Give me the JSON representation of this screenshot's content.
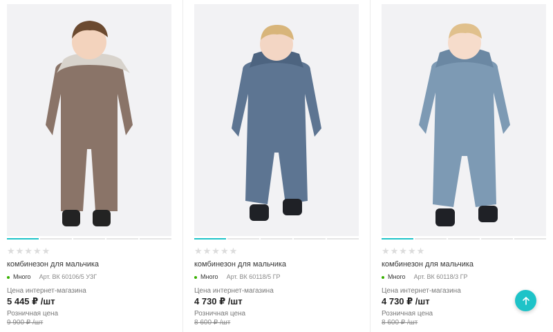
{
  "products": [
    {
      "rating_stars": "★★★★★",
      "title": "комбинезон для мальчика",
      "stock": "Много",
      "article": "Арт. ВК 60106/5 УЗГ",
      "price_label": "Цена интернет-магазина",
      "price": "5 445 ₽ /шт",
      "retail_label": "Розничная цена",
      "retail_price": "9 900 ₽ /шт",
      "suit_color": "#8a7468",
      "image_slide_active": 1,
      "image_slide_count": 5
    },
    {
      "rating_stars": "★★★★★",
      "title": "комбинезон для мальчика",
      "stock": "Много",
      "article": "Арт. ВК 60118/5 ГР",
      "price_label": "Цена интернет-магазина",
      "price": "4 730 ₽ /шт",
      "retail_label": "Розничная цена",
      "retail_price": "8 600 ₽ /шт",
      "suit_color": "#5d7592",
      "image_slide_active": 1,
      "image_slide_count": 5
    },
    {
      "rating_stars": "★★★★★",
      "title": "комбинезон для мальчика",
      "stock": "Много",
      "article": "Арт. ВК 60118/3 ГР",
      "price_label": "Цена интернет-магазина",
      "price": "4 730 ₽ /шт",
      "retail_label": "Розничная цена",
      "retail_price": "8 600 ₽ /шт",
      "suit_color": "#7d9ab4",
      "image_slide_active": 1,
      "image_slide_count": 5
    }
  ],
  "colors": {
    "accent": "#1ec3c8",
    "stock_dot": "#38b000",
    "stars_inactive": "#dcdcdc"
  },
  "scroll_top_icon": "arrow-up-icon"
}
